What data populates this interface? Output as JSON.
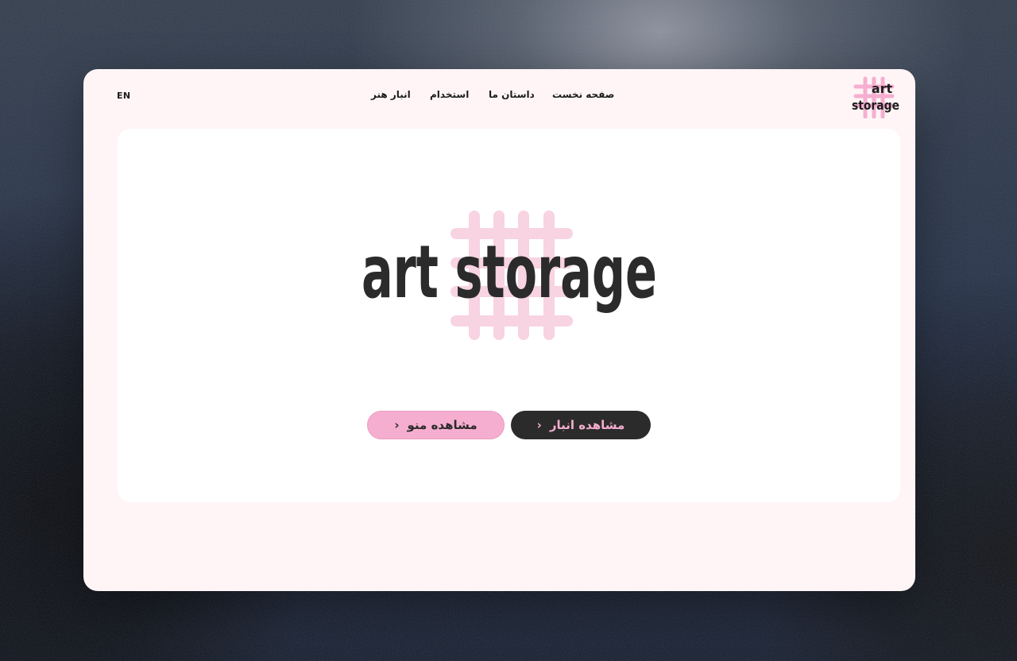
{
  "brand": {
    "name": "art storage",
    "line1": "art",
    "line2": "storage",
    "colors": {
      "accent_pink": "#f6aed0",
      "grid_pink": "#f8d3e2",
      "dark": "#2b2b2b",
      "window_bg": "#fff5f6"
    }
  },
  "header": {
    "lang_toggle": "EN",
    "nav": [
      {
        "label": "صفحه نخست"
      },
      {
        "label": "داستان ما"
      },
      {
        "label": "استخدام"
      },
      {
        "label": "انبار هنر"
      }
    ]
  },
  "hero": {
    "logo_text": "art storage",
    "buttons": {
      "primary": {
        "label": "مشاهده انبار",
        "icon": "chevron-left-icon"
      },
      "secondary": {
        "label": "مشاهده منو",
        "icon": "chevron-left-icon"
      }
    }
  }
}
